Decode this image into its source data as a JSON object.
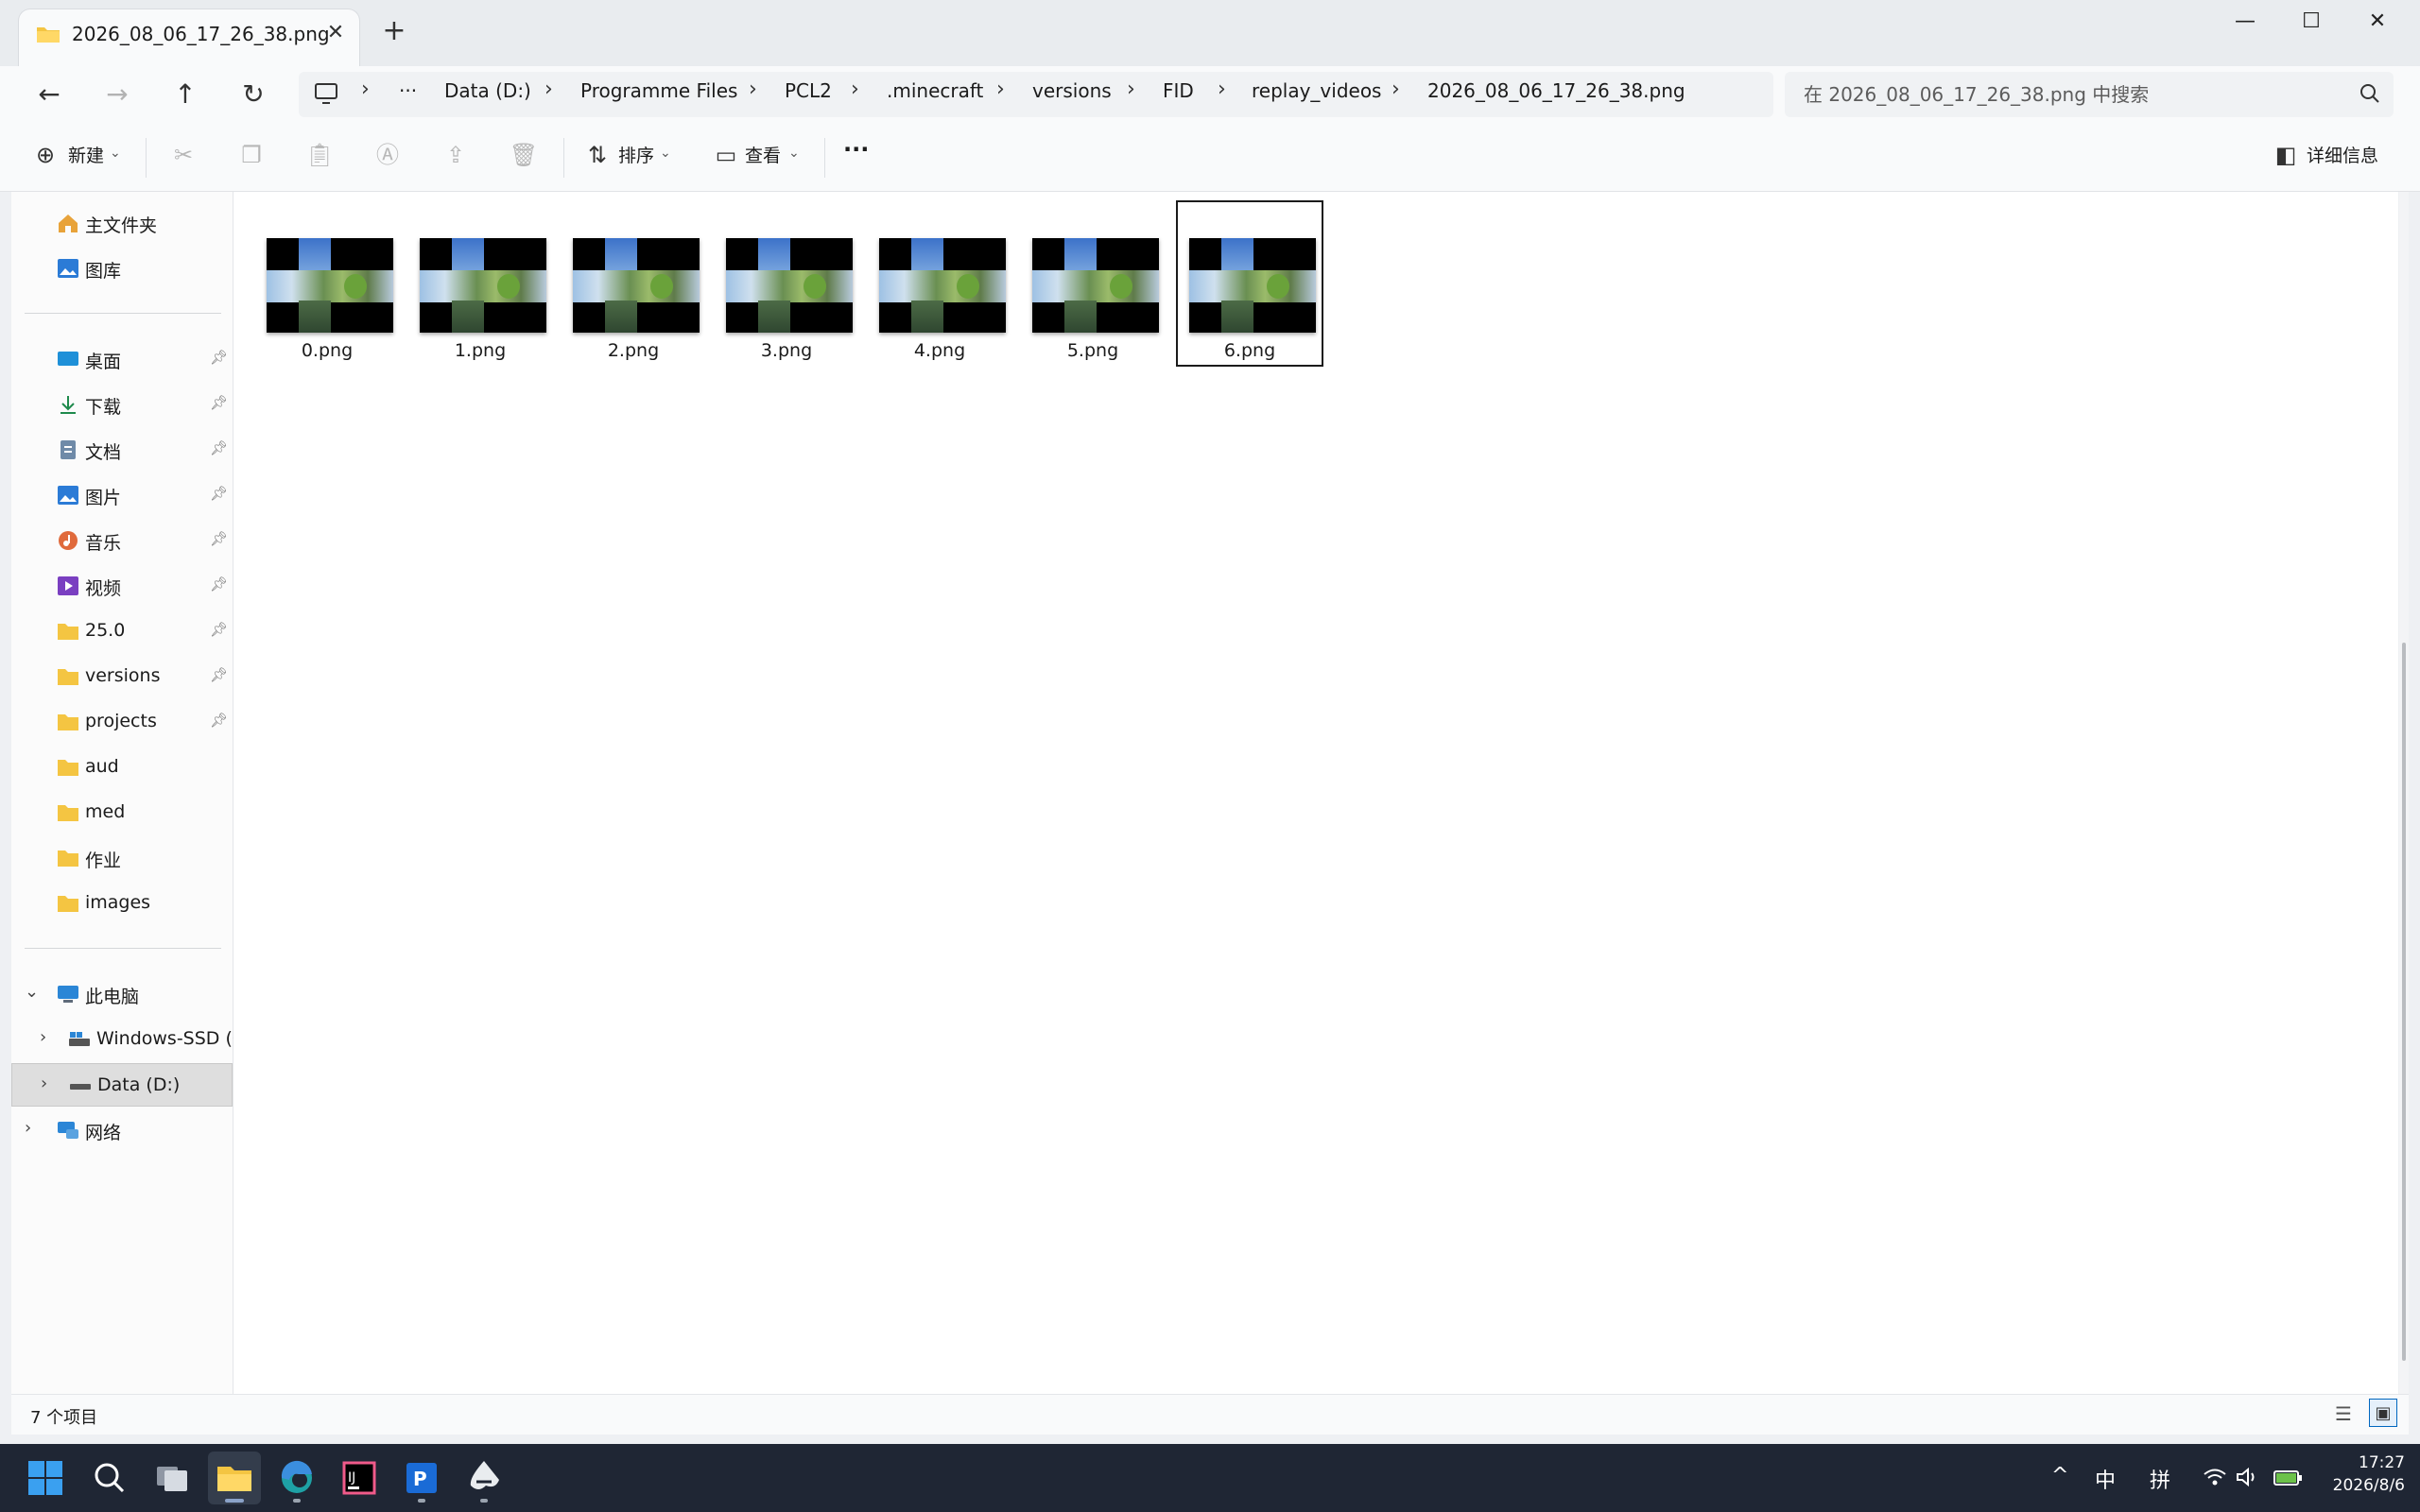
{
  "window": {
    "tab_title": "2026_08_06_17_26_38.png",
    "tab_close_icon": "close-icon",
    "new_tab_icon": "plus-icon",
    "controls": [
      "minimize-icon",
      "maximize-icon",
      "close-icon"
    ]
  },
  "address": {
    "breadcrumbs": [
      "Data (D:)",
      "Programme Files",
      "PCL2",
      ".minecraft",
      "versions",
      "FID",
      "replay_videos",
      "2026_08_06_17_26_38.png"
    ],
    "overflow": "···"
  },
  "search": {
    "placeholder": "在 2026_08_06_17_26_38.png 中搜索"
  },
  "toolbar": {
    "new_label": "新建",
    "sort_label": "排序",
    "view_label": "查看",
    "more_label": "···",
    "details_label": "详细信息"
  },
  "sidebar": {
    "top": [
      {
        "label": "主文件夹",
        "icon": "home-icon"
      },
      {
        "label": "图库",
        "icon": "gallery-icon"
      }
    ],
    "quick": [
      {
        "label": "桌面",
        "icon": "desktop-icon",
        "pinned": true
      },
      {
        "label": "下载",
        "icon": "download-icon",
        "pinned": true
      },
      {
        "label": "文档",
        "icon": "document-icon",
        "pinned": true
      },
      {
        "label": "图片",
        "icon": "pictures-icon",
        "pinned": true
      },
      {
        "label": "音乐",
        "icon": "music-icon",
        "pinned": true
      },
      {
        "label": "视频",
        "icon": "video-icon",
        "pinned": true
      },
      {
        "label": "25.0",
        "icon": "folder-icon",
        "pinned": true
      },
      {
        "label": "versions",
        "icon": "folder-icon",
        "pinned": true
      },
      {
        "label": "projects",
        "icon": "folder-icon",
        "pinned": true
      },
      {
        "label": "aud",
        "icon": "folder-icon",
        "pinned": false
      },
      {
        "label": "med",
        "icon": "folder-icon",
        "pinned": false
      },
      {
        "label": "作业",
        "icon": "folder-icon",
        "pinned": false
      },
      {
        "label": "images",
        "icon": "folder-icon",
        "pinned": false
      }
    ],
    "this_pc": {
      "label": "此电脑",
      "icon": "computer-icon"
    },
    "drive_c": {
      "label": "Windows-SSD (C",
      "icon": "drive-icon"
    },
    "drive_d": {
      "label": "Data (D:)",
      "icon": "drive-icon",
      "selected": true
    },
    "network": {
      "label": "网络",
      "icon": "network-icon"
    }
  },
  "files": [
    {
      "name": "0.png"
    },
    {
      "name": "1.png"
    },
    {
      "name": "2.png"
    },
    {
      "name": "3.png"
    },
    {
      "name": "4.png"
    },
    {
      "name": "5.png"
    },
    {
      "name": "6.png",
      "selected": true
    }
  ],
  "status": {
    "item_count": "7 个项目"
  },
  "taskbar": {
    "apps": [
      "start-icon",
      "search-icon",
      "task-view-icon",
      "file-explorer-icon",
      "edge-icon",
      "intellij-icon",
      "pycharm-icon",
      "inkscape-icon"
    ],
    "tray": {
      "chevron": "^",
      "ime_mode": "中",
      "ime_pinyin": "拼",
      "icons": [
        "wifi-icon",
        "volume-icon",
        "battery-icon"
      ]
    },
    "time": "17:27",
    "date": "2026/8/6"
  },
  "colors": {
    "accent": "#0067c0",
    "folder": "#f4c542",
    "taskbar": "#1f2634"
  }
}
